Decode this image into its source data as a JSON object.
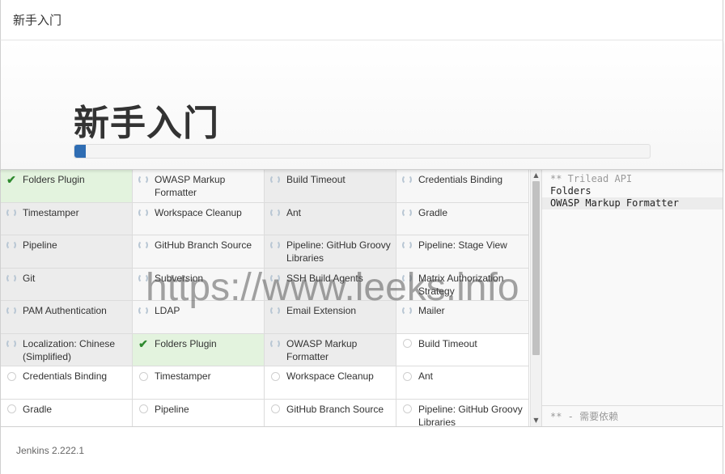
{
  "topbar": {
    "title": "新手入门"
  },
  "hero": {
    "title": "新手入门",
    "progress_fraction": 0.02,
    "progress_color": "#2f6db3"
  },
  "plugins": [
    {
      "name": "Folders Plugin",
      "status": "success"
    },
    {
      "name": "OWASP Markup Formatter",
      "status": "installing"
    },
    {
      "name": "Build Timeout",
      "status": "installing"
    },
    {
      "name": "Credentials Binding",
      "status": "installing"
    },
    {
      "name": "Timestamper",
      "status": "installing"
    },
    {
      "name": "Workspace Cleanup",
      "status": "installing"
    },
    {
      "name": "Ant",
      "status": "installing"
    },
    {
      "name": "Gradle",
      "status": "installing"
    },
    {
      "name": "Pipeline",
      "status": "installing"
    },
    {
      "name": "GitHub Branch Source",
      "status": "installing"
    },
    {
      "name": "Pipeline: GitHub Groovy Libraries",
      "status": "installing"
    },
    {
      "name": "Pipeline: Stage View",
      "status": "installing"
    },
    {
      "name": "Git",
      "status": "installing"
    },
    {
      "name": "Subversion",
      "status": "installing"
    },
    {
      "name": "SSH Build Agents",
      "status": "installing"
    },
    {
      "name": "Matrix Authorization Strategy",
      "status": "installing"
    },
    {
      "name": "PAM Authentication",
      "status": "installing"
    },
    {
      "name": "LDAP",
      "status": "installing"
    },
    {
      "name": "Email Extension",
      "status": "installing"
    },
    {
      "name": "Mailer",
      "status": "installing"
    },
    {
      "name": "Localization: Chinese (Simplified)",
      "status": "installing"
    },
    {
      "name": "Folders Plugin",
      "status": "success"
    },
    {
      "name": "OWASP Markup Formatter",
      "status": "installing"
    },
    {
      "name": "Build Timeout",
      "status": "pending"
    },
    {
      "name": "Credentials Binding",
      "status": "pending"
    },
    {
      "name": "Timestamper",
      "status": "pending"
    },
    {
      "name": "Workspace Cleanup",
      "status": "pending"
    },
    {
      "name": "Ant",
      "status": "pending"
    },
    {
      "name": "Gradle",
      "status": "pending"
    },
    {
      "name": "Pipeline",
      "status": "pending"
    },
    {
      "name": "GitHub Branch Source",
      "status": "pending"
    },
    {
      "name": "Pipeline: GitHub Groovy Libraries",
      "status": "pending"
    }
  ],
  "log": {
    "lines": [
      {
        "text": "** Trilead API",
        "style": "dim"
      },
      {
        "text": "Folders",
        "style": "normal"
      },
      {
        "text": "OWASP Markup Formatter",
        "style": "current"
      }
    ],
    "footer": "** - 需要依赖"
  },
  "footer": {
    "version": "Jenkins 2.222.1"
  },
  "watermark": "https://www.leeks.info"
}
